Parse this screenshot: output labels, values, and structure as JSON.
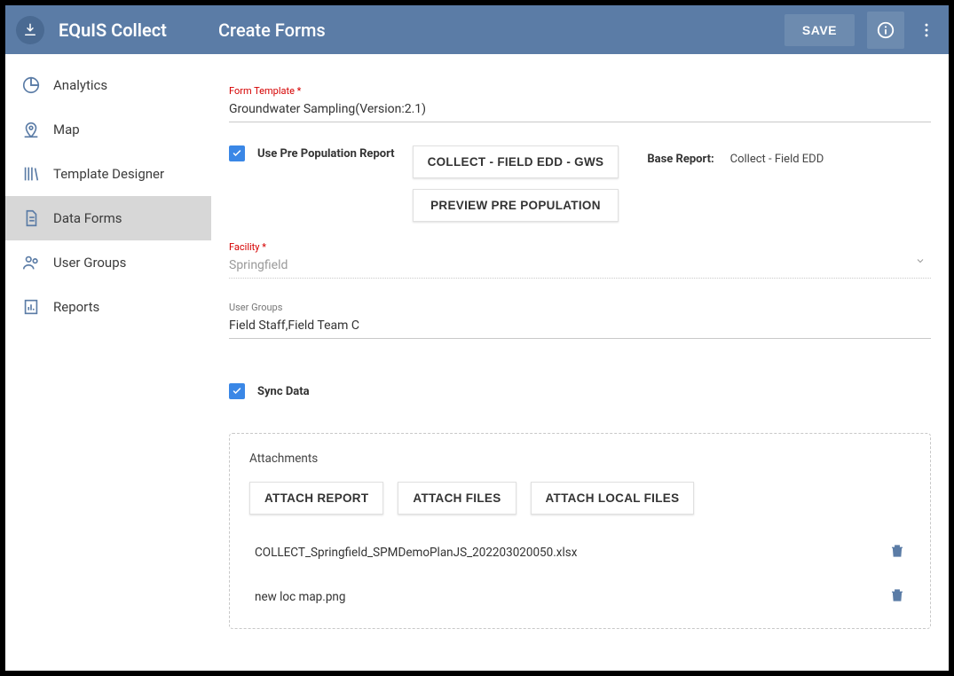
{
  "header": {
    "app_title": "EQuIS Collect",
    "page_title": "Create Forms",
    "save_label": "SAVE"
  },
  "sidebar": {
    "items": [
      {
        "label": "Analytics"
      },
      {
        "label": "Map"
      },
      {
        "label": "Template Designer"
      },
      {
        "label": "Data Forms"
      },
      {
        "label": "User Groups"
      },
      {
        "label": "Reports"
      }
    ]
  },
  "form": {
    "template_label": "Form Template *",
    "template_value": "Groundwater Sampling(Version:2.1)",
    "use_pp_label": "Use Pre Population Report",
    "btn_collect": "COLLECT - FIELD EDD - GWS",
    "btn_preview": "PREVIEW PRE POPULATION",
    "base_report_label": "Base Report:",
    "base_report_value": "Collect - Field EDD",
    "facility_label": "Facility *",
    "facility_value": "Springfield",
    "user_groups_label": "User Groups",
    "user_groups_value": "Field Staff,Field Team C",
    "sync_label": "Sync Data",
    "attachments_title": "Attachments",
    "btn_attach_report": "ATTACH REPORT",
    "btn_attach_files": "ATTACH FILES",
    "btn_attach_local": "ATTACH LOCAL FILES",
    "files": [
      {
        "name": "COLLECT_Springfield_SPMDemoPlanJS_202203020050.xlsx"
      },
      {
        "name": "new loc map.png"
      }
    ]
  }
}
